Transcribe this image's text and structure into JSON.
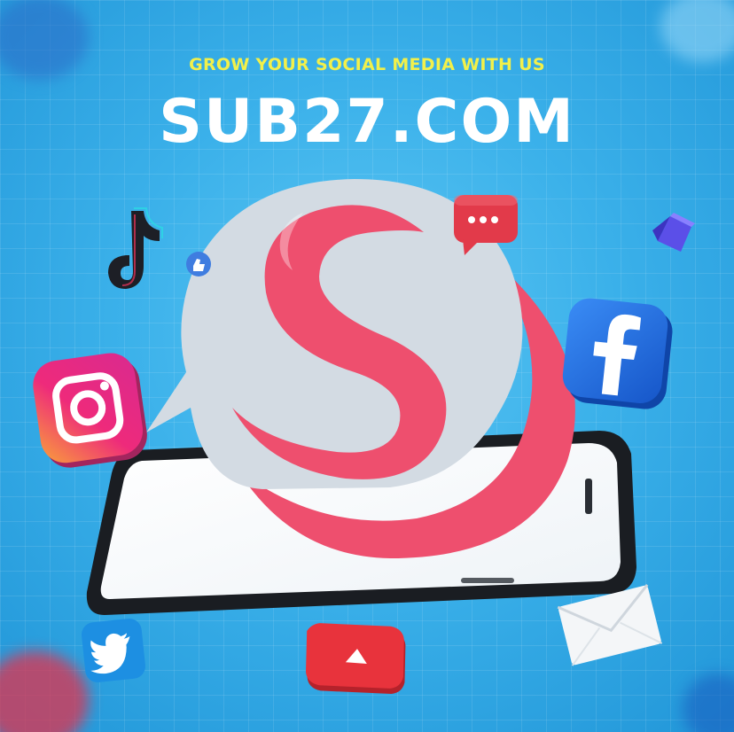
{
  "header": {
    "tagline": "GROW YOUR SOCIAL MEDIA WITH US",
    "brand": "SUB27.COM"
  },
  "colors": {
    "background": "#3bb1ea",
    "tagline": "#f2f04a",
    "brand_text": "#ffffff",
    "logo_pink": "#ee4f6e",
    "bubble_gray": "#d3dbe3",
    "facebook": "#1f6fe0",
    "youtube": "#e8333c"
  },
  "icons": [
    "tiktok-icon",
    "like-thumb-icon",
    "chat-bubble-icon",
    "cube-icon",
    "instagram-icon",
    "facebook-icon",
    "twitter-icon",
    "youtube-icon",
    "envelope-icon",
    "smartphone",
    "sub27-logo"
  ]
}
